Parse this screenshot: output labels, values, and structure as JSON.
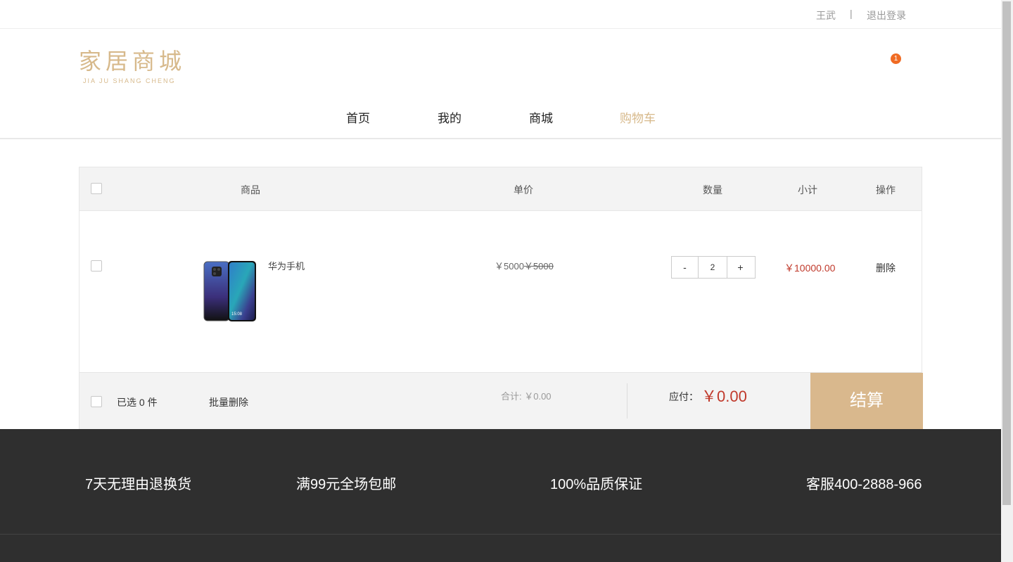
{
  "topbar": {
    "user_name": "王武",
    "separator": "|",
    "logout_label": "退出登录"
  },
  "logo": {
    "cn": "家居商城",
    "en": "JIA JU SHANG CHENG"
  },
  "cart_badge": "1",
  "nav": {
    "home": "首页",
    "mine": "我的",
    "mall": "商城",
    "cart": "购物车",
    "active": "购物车"
  },
  "cart": {
    "headers": {
      "product": "商品",
      "unit_price": "单价",
      "quantity": "数量",
      "subtotal": "小计",
      "action": "操作"
    },
    "item": {
      "name": "华为手机",
      "price": "￥5000",
      "original_price": "￥5000",
      "quantity": "2",
      "minus_label": "-",
      "plus_label": "+",
      "subtotal": "￥10000.00",
      "delete_label": "删除"
    },
    "footer": {
      "selected_label": "已选 0 件",
      "batch_delete_label": "批量删除",
      "total_label": "合计: ￥0.00",
      "pay_label": "应付：",
      "pay_amount": "￥0.00",
      "checkout_label": "结算"
    }
  },
  "footer": {
    "promos": [
      "7天无理由退换货",
      "满99元全场包邮",
      "100%品质保证",
      "客服400-2888-966"
    ]
  },
  "colors": {
    "accent": "#d9b88d",
    "price_red": "#c0392b",
    "badge": "#f06b23",
    "footer_bg": "#2f2f2f"
  }
}
